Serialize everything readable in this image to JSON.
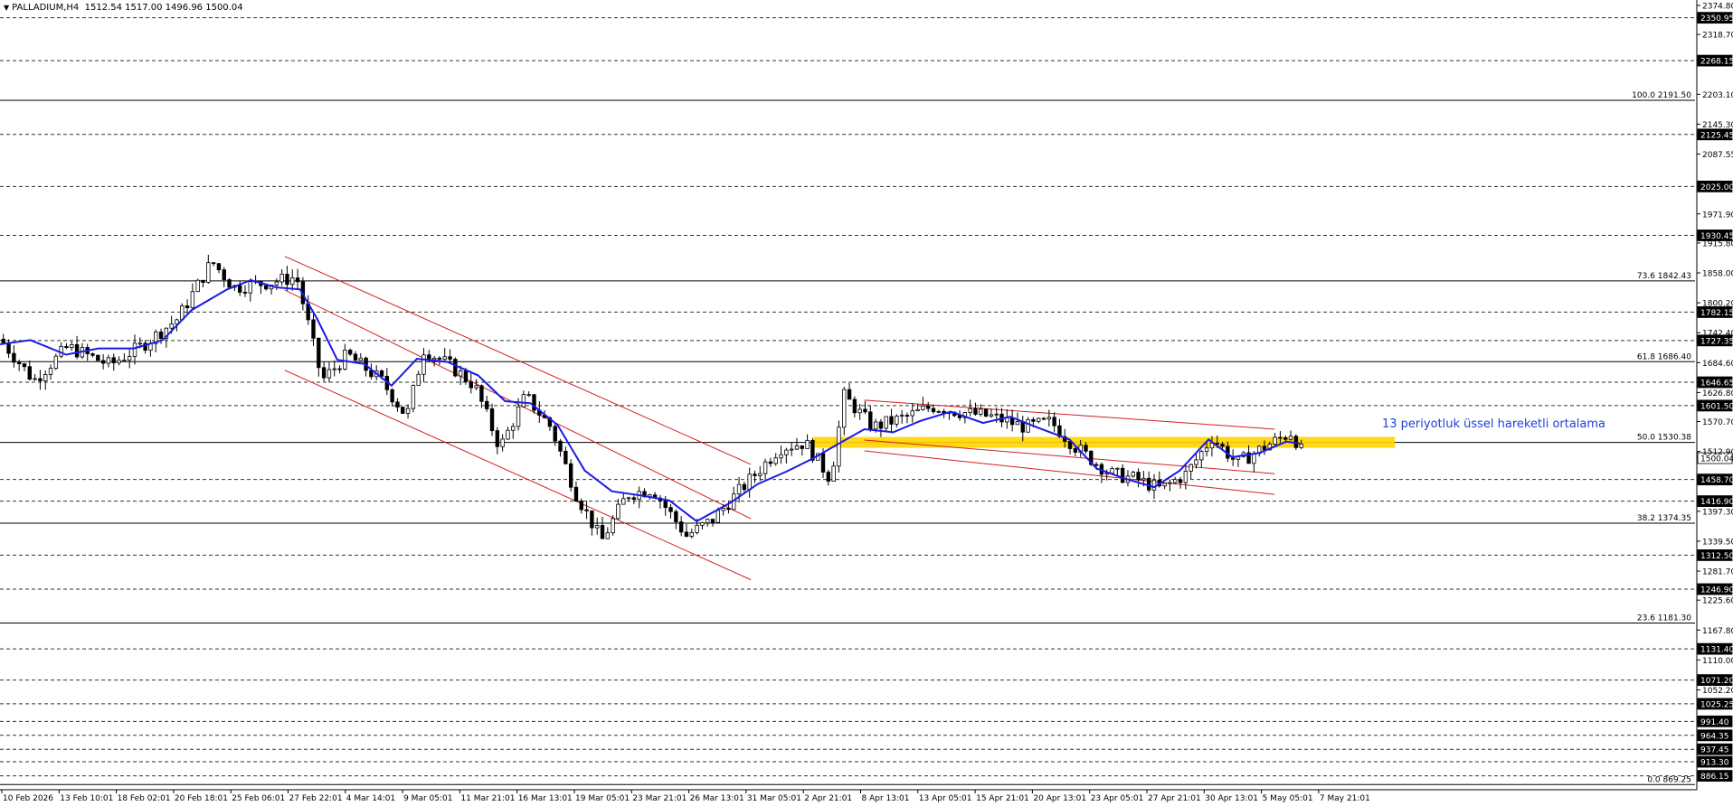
{
  "header": {
    "symbol": "PALLADIUM,H4",
    "ohlc": "1512.54 1517.00 1496.96 1500.04"
  },
  "annotation": "13 periyotluk üssel hareketli ortalama",
  "colors": {
    "background": "#ffffff",
    "axis": "#000000",
    "candle": "#000000",
    "ema": "#1a1ae6",
    "channel": "#d42020",
    "zone": "#ffd400",
    "annotation": "#1c3fd8"
  },
  "icons": {
    "header_marker": "triangle-down-icon"
  },
  "chart_data": {
    "type": "candlestick",
    "symbol": "PALLADIUM",
    "timeframe": "H4",
    "ylim": [
      859.25,
      2374.8
    ],
    "last_price": 1500.04,
    "current_price_label": "1500.04",
    "y_tick_labels": [
      "2374.80",
      "2350.95",
      "2318.70",
      "2268.15",
      "2203.10",
      "2145.30",
      "2125.45",
      "2087.55",
      "2025.00",
      "1971.90",
      "1930.45",
      "1915.80",
      "1858.00",
      "1800.20",
      "1782.15",
      "1742.40",
      "1727.35",
      "1684.60",
      "1646.65",
      "1626.80",
      "1601.50",
      "1570.70",
      "1500.04",
      "1512.90",
      "1458.70",
      "1416.90",
      "1397.30",
      "1339.50",
      "1312.50",
      "1281.70",
      "1246.90",
      "1225.60",
      "1167.80",
      "1131.40",
      "1110.00",
      "1071.20",
      "1052.20",
      "1025.25",
      "991.40",
      "964.35",
      "937.45",
      "913.30",
      "886.15"
    ],
    "x_tick_labels": [
      "10 Feb 2026",
      "13 Feb 10:01",
      "18 Feb 02:01",
      "20 Feb 18:01",
      "25 Feb 06:01",
      "27 Feb 22:01",
      "4 Mar 14:01",
      "9 Mar 05:01",
      "11 Mar 21:01",
      "16 Mar 13:01",
      "19 Mar 05:01",
      "23 Mar 21:01",
      "26 Mar 13:01",
      "31 Mar 05:01",
      "2 Apr 21:01",
      "8 Apr 13:01",
      "13 Apr 05:01",
      "15 Apr 21:01",
      "20 Apr 13:01",
      "23 Apr 05:01",
      "27 Apr 21:01",
      "30 Apr 13:01",
      "5 May 05:01",
      "7 May 21:01"
    ],
    "highlighted_levels": [
      2350.95,
      2268.15,
      2125.45,
      2025.0,
      1930.45,
      1782.15,
      1727.35,
      1646.65,
      1601.5,
      1458.7,
      1416.9,
      1312.5,
      1246.9,
      1131.4,
      1071.2,
      1025.25,
      991.4,
      964.35,
      937.45,
      913.3,
      886.15
    ],
    "fibonacci": [
      {
        "label": "100.0 2191.50",
        "value": 2191.5
      },
      {
        "label": "73.6 1842.43",
        "value": 1842.43
      },
      {
        "label": "61.8 1686.40",
        "value": 1686.4
      },
      {
        "label": "50.0 1530.38",
        "value": 1530.38
      },
      {
        "label": "38.2 1374.35",
        "value": 1374.35
      },
      {
        "label": "23.6 1181.30",
        "value": 1181.3
      },
      {
        "label": "0.0 869.25",
        "value": 869.25
      }
    ],
    "zone": {
      "x_from": 0.479,
      "x_to": 0.823,
      "y_low": 1520,
      "y_high": 1541
    },
    "ema_period": 13,
    "ema_waypoints": [
      [
        0,
        1720
      ],
      [
        0.018,
        1728
      ],
      [
        0.039,
        1700
      ],
      [
        0.058,
        1712
      ],
      [
        0.079,
        1712
      ],
      [
        0.096,
        1728
      ],
      [
        0.113,
        1786
      ],
      [
        0.134,
        1826
      ],
      [
        0.148,
        1844
      ],
      [
        0.163,
        1830
      ],
      [
        0.177,
        1826
      ],
      [
        0.187,
        1770
      ],
      [
        0.199,
        1690
      ],
      [
        0.215,
        1682
      ],
      [
        0.231,
        1640
      ],
      [
        0.246,
        1692
      ],
      [
        0.264,
        1686
      ],
      [
        0.282,
        1660
      ],
      [
        0.298,
        1610
      ],
      [
        0.313,
        1606
      ],
      [
        0.329,
        1564
      ],
      [
        0.345,
        1476
      ],
      [
        0.361,
        1436
      ],
      [
        0.378,
        1428
      ],
      [
        0.395,
        1418
      ],
      [
        0.411,
        1378
      ],
      [
        0.431,
        1414
      ],
      [
        0.447,
        1450
      ],
      [
        0.464,
        1474
      ],
      [
        0.48,
        1500
      ],
      [
        0.496,
        1530
      ],
      [
        0.51,
        1556
      ],
      [
        0.527,
        1550
      ],
      [
        0.543,
        1572
      ],
      [
        0.561,
        1590
      ],
      [
        0.58,
        1568
      ],
      [
        0.596,
        1580
      ],
      [
        0.613,
        1558
      ],
      [
        0.631,
        1536
      ],
      [
        0.647,
        1480
      ],
      [
        0.664,
        1460
      ],
      [
        0.681,
        1444
      ],
      [
        0.696,
        1476
      ],
      [
        0.713,
        1536
      ],
      [
        0.727,
        1502
      ],
      [
        0.743,
        1510
      ],
      [
        0.759,
        1532
      ],
      [
        0.767,
        1528
      ]
    ],
    "candle_waypoints": [
      [
        0,
        1730
      ],
      [
        0.02,
        1650
      ],
      [
        0.04,
        1715
      ],
      [
        0.065,
        1680
      ],
      [
        0.085,
        1720
      ],
      [
        0.105,
        1770
      ],
      [
        0.125,
        1880
      ],
      [
        0.138,
        1830
      ],
      [
        0.16,
        1840
      ],
      [
        0.175,
        1850
      ],
      [
        0.19,
        1650
      ],
      [
        0.205,
        1700
      ],
      [
        0.225,
        1650
      ],
      [
        0.24,
        1580
      ],
      [
        0.25,
        1710
      ],
      [
        0.265,
        1680
      ],
      [
        0.28,
        1640
      ],
      [
        0.295,
        1520
      ],
      [
        0.31,
        1620
      ],
      [
        0.325,
        1560
      ],
      [
        0.34,
        1430
      ],
      [
        0.355,
        1340
      ],
      [
        0.37,
        1430
      ],
      [
        0.385,
        1440
      ],
      [
        0.405,
        1350
      ],
      [
        0.42,
        1380
      ],
      [
        0.44,
        1450
      ],
      [
        0.46,
        1520
      ],
      [
        0.475,
        1530
      ],
      [
        0.49,
        1460
      ],
      [
        0.498,
        1620
      ],
      [
        0.515,
        1560
      ],
      [
        0.535,
        1580
      ],
      [
        0.55,
        1600
      ],
      [
        0.565,
        1590
      ],
      [
        0.585,
        1580
      ],
      [
        0.605,
        1560
      ],
      [
        0.62,
        1570
      ],
      [
        0.635,
        1520
      ],
      [
        0.655,
        1470
      ],
      [
        0.67,
        1460
      ],
      [
        0.685,
        1440
      ],
      [
        0.7,
        1470
      ],
      [
        0.715,
        1540
      ],
      [
        0.73,
        1490
      ],
      [
        0.745,
        1520
      ],
      [
        0.762,
        1550
      ],
      [
        0.77,
        1500
      ]
    ],
    "channels": [
      {
        "points": [
          [
            0.168,
            1890
          ],
          [
            0.443,
            1488
          ]
        ]
      },
      {
        "points": [
          [
            0.168,
            1825
          ],
          [
            0.443,
            1383
          ]
        ]
      },
      {
        "points": [
          [
            0.168,
            1670
          ],
          [
            0.443,
            1265
          ]
        ]
      },
      {
        "points": [
          [
            0.51,
            1612
          ],
          [
            0.752,
            1556
          ]
        ]
      },
      {
        "points": [
          [
            0.51,
            1535
          ],
          [
            0.752,
            1470
          ]
        ]
      },
      {
        "points": [
          [
            0.51,
            1514
          ],
          [
            0.752,
            1430
          ]
        ]
      }
    ]
  }
}
